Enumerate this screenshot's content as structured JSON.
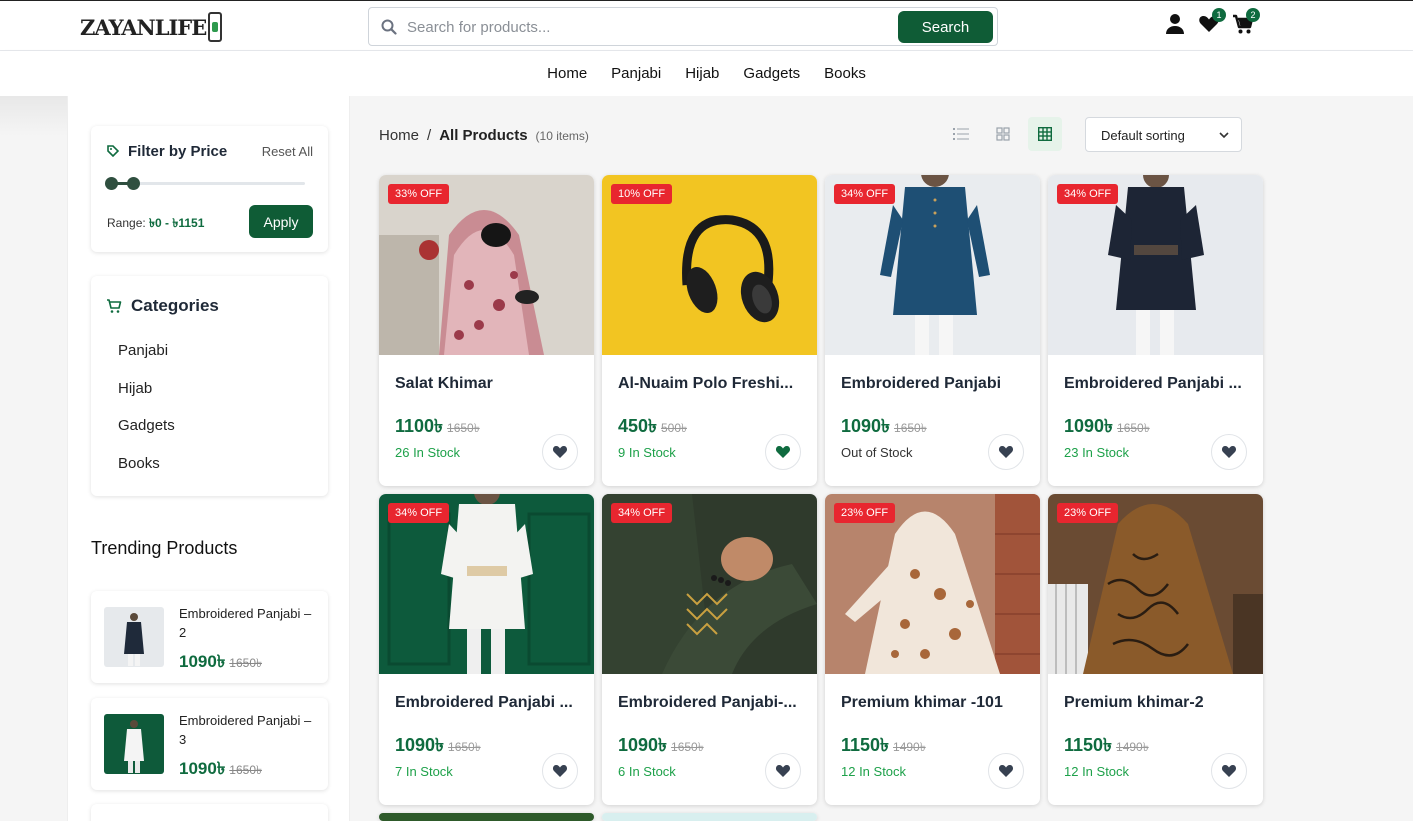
{
  "header": {
    "logo": "ZAYANLIFE",
    "search_placeholder": "Search for products...",
    "search_button": "Search",
    "wishlist_count": "1",
    "cart_count": "2"
  },
  "nav": [
    "Home",
    "Panjabi",
    "Hijab",
    "Gadgets",
    "Books"
  ],
  "filter": {
    "title": "Filter by Price",
    "reset": "Reset All",
    "range_label": "Range:",
    "range_value": "৳0 - ৳1151",
    "apply": "Apply"
  },
  "categories": {
    "title": "Categories",
    "items": [
      "Panjabi",
      "Hijab",
      "Gadgets",
      "Books"
    ]
  },
  "trending": {
    "title": "Trending Products",
    "items": [
      {
        "name": "Embroidered Panjabi – 2",
        "price": "1090৳",
        "old": "1650৳"
      },
      {
        "name": "Embroidered Panjabi – 3",
        "price": "1090৳",
        "old": "1650৳"
      }
    ]
  },
  "breadcrumb": {
    "home": "Home",
    "sep": "/",
    "current": "All Products",
    "count": "(10 items)"
  },
  "sort": "Default sorting",
  "products": [
    {
      "name": "Salat Khimar",
      "price": "1100৳",
      "old": "1650৳",
      "stock": "26 In Stock",
      "discount": "33% OFF",
      "fav": false
    },
    {
      "name": "Al-Nuaim Polo Freshi...",
      "price": "450৳",
      "old": "500৳",
      "stock": "9 In Stock",
      "discount": "10% OFF",
      "fav": true
    },
    {
      "name": "Embroidered Panjabi",
      "price": "1090৳",
      "old": "1650৳",
      "stock": "Out of Stock",
      "discount": "34% OFF",
      "fav": false
    },
    {
      "name": "Embroidered Panjabi ...",
      "price": "1090৳",
      "old": "1650৳",
      "stock": "23 In Stock",
      "discount": "34% OFF",
      "fav": false
    },
    {
      "name": "Embroidered Panjabi ...",
      "price": "1090৳",
      "old": "1650৳",
      "stock": "7 In Stock",
      "discount": "34% OFF",
      "fav": false
    },
    {
      "name": "Embroidered Panjabi-...",
      "price": "1090৳",
      "old": "1650৳",
      "stock": "6 In Stock",
      "discount": "34% OFF",
      "fav": false
    },
    {
      "name": "Premium khimar -101",
      "price": "1150৳",
      "old": "1490৳",
      "stock": "12 In Stock",
      "discount": "23% OFF",
      "fav": false
    },
    {
      "name": "Premium khimar-2",
      "price": "1150৳",
      "old": "1490৳",
      "stock": "12 In Stock",
      "discount": "23% OFF",
      "fav": false
    }
  ],
  "colors": {
    "brand": "#0f5c36",
    "accent_green": "#0f6b3f",
    "stock_green": "#1ea14a",
    "discount_red": "#e8262f"
  }
}
